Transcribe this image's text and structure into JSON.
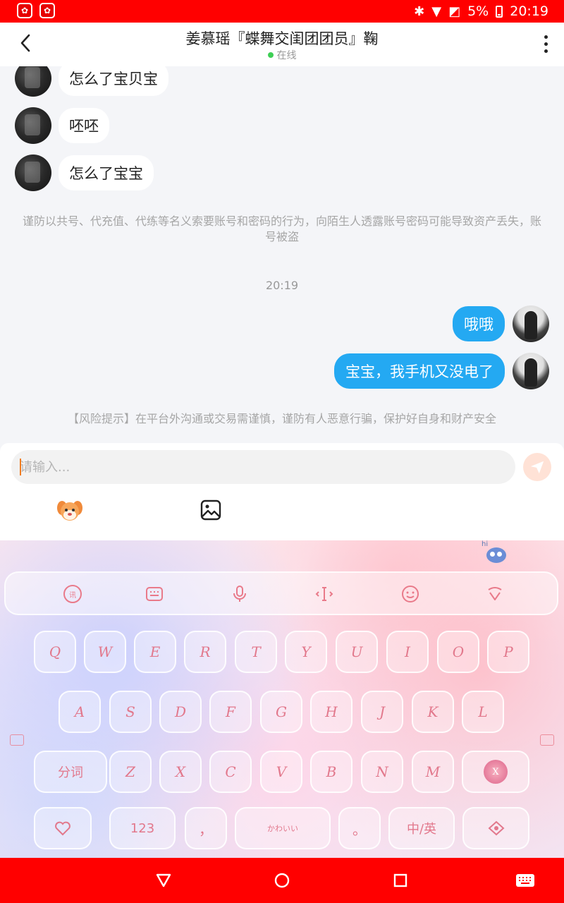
{
  "status_bar": {
    "battery": "5%",
    "time": "20:19"
  },
  "header": {
    "title": "姜慕瑶『蝶舞交闺团团员』鞠",
    "presence": "在线"
  },
  "chat": {
    "messages_in": [
      {
        "text": "怎么了宝贝宝"
      },
      {
        "text": "呸呸"
      },
      {
        "text": "怎么了宝宝"
      }
    ],
    "security_notice": "谨防以共号、代充值、代练等名义索要账号和密码的行为，向陌生人透露账号密码可能导致资产丢失，账号被盗",
    "timestamp": "20:19",
    "messages_out": [
      {
        "text": "哦哦"
      },
      {
        "text": "宝宝，我手机又没电了"
      }
    ],
    "risk_notice": "【风险提示】在平台外沟通或交易需谨慎，谨防有人恶意行骗，保护好自身和财产安全"
  },
  "composer": {
    "placeholder": "请输入..."
  },
  "keyboard": {
    "hi_label": "hi",
    "row1": [
      "Q",
      "W",
      "E",
      "R",
      "T",
      "Y",
      "U",
      "I",
      "O",
      "P"
    ],
    "row2": [
      "A",
      "S",
      "D",
      "F",
      "G",
      "H",
      "J",
      "K",
      "L"
    ],
    "row3_left": "分词",
    "row3": [
      "Z",
      "X",
      "C",
      "V",
      "B",
      "N",
      "M"
    ],
    "numeric_key": "123",
    "comma_key": "，",
    "period_key": "。",
    "lang_key": "中/英",
    "space_deco": "かわいい",
    "delete_key": "X"
  },
  "colors": {
    "status_bar": "#ff0000",
    "bubble_out": "#24a9f2",
    "online_dot": "#3ecf55",
    "key_text": "#e2788c"
  }
}
